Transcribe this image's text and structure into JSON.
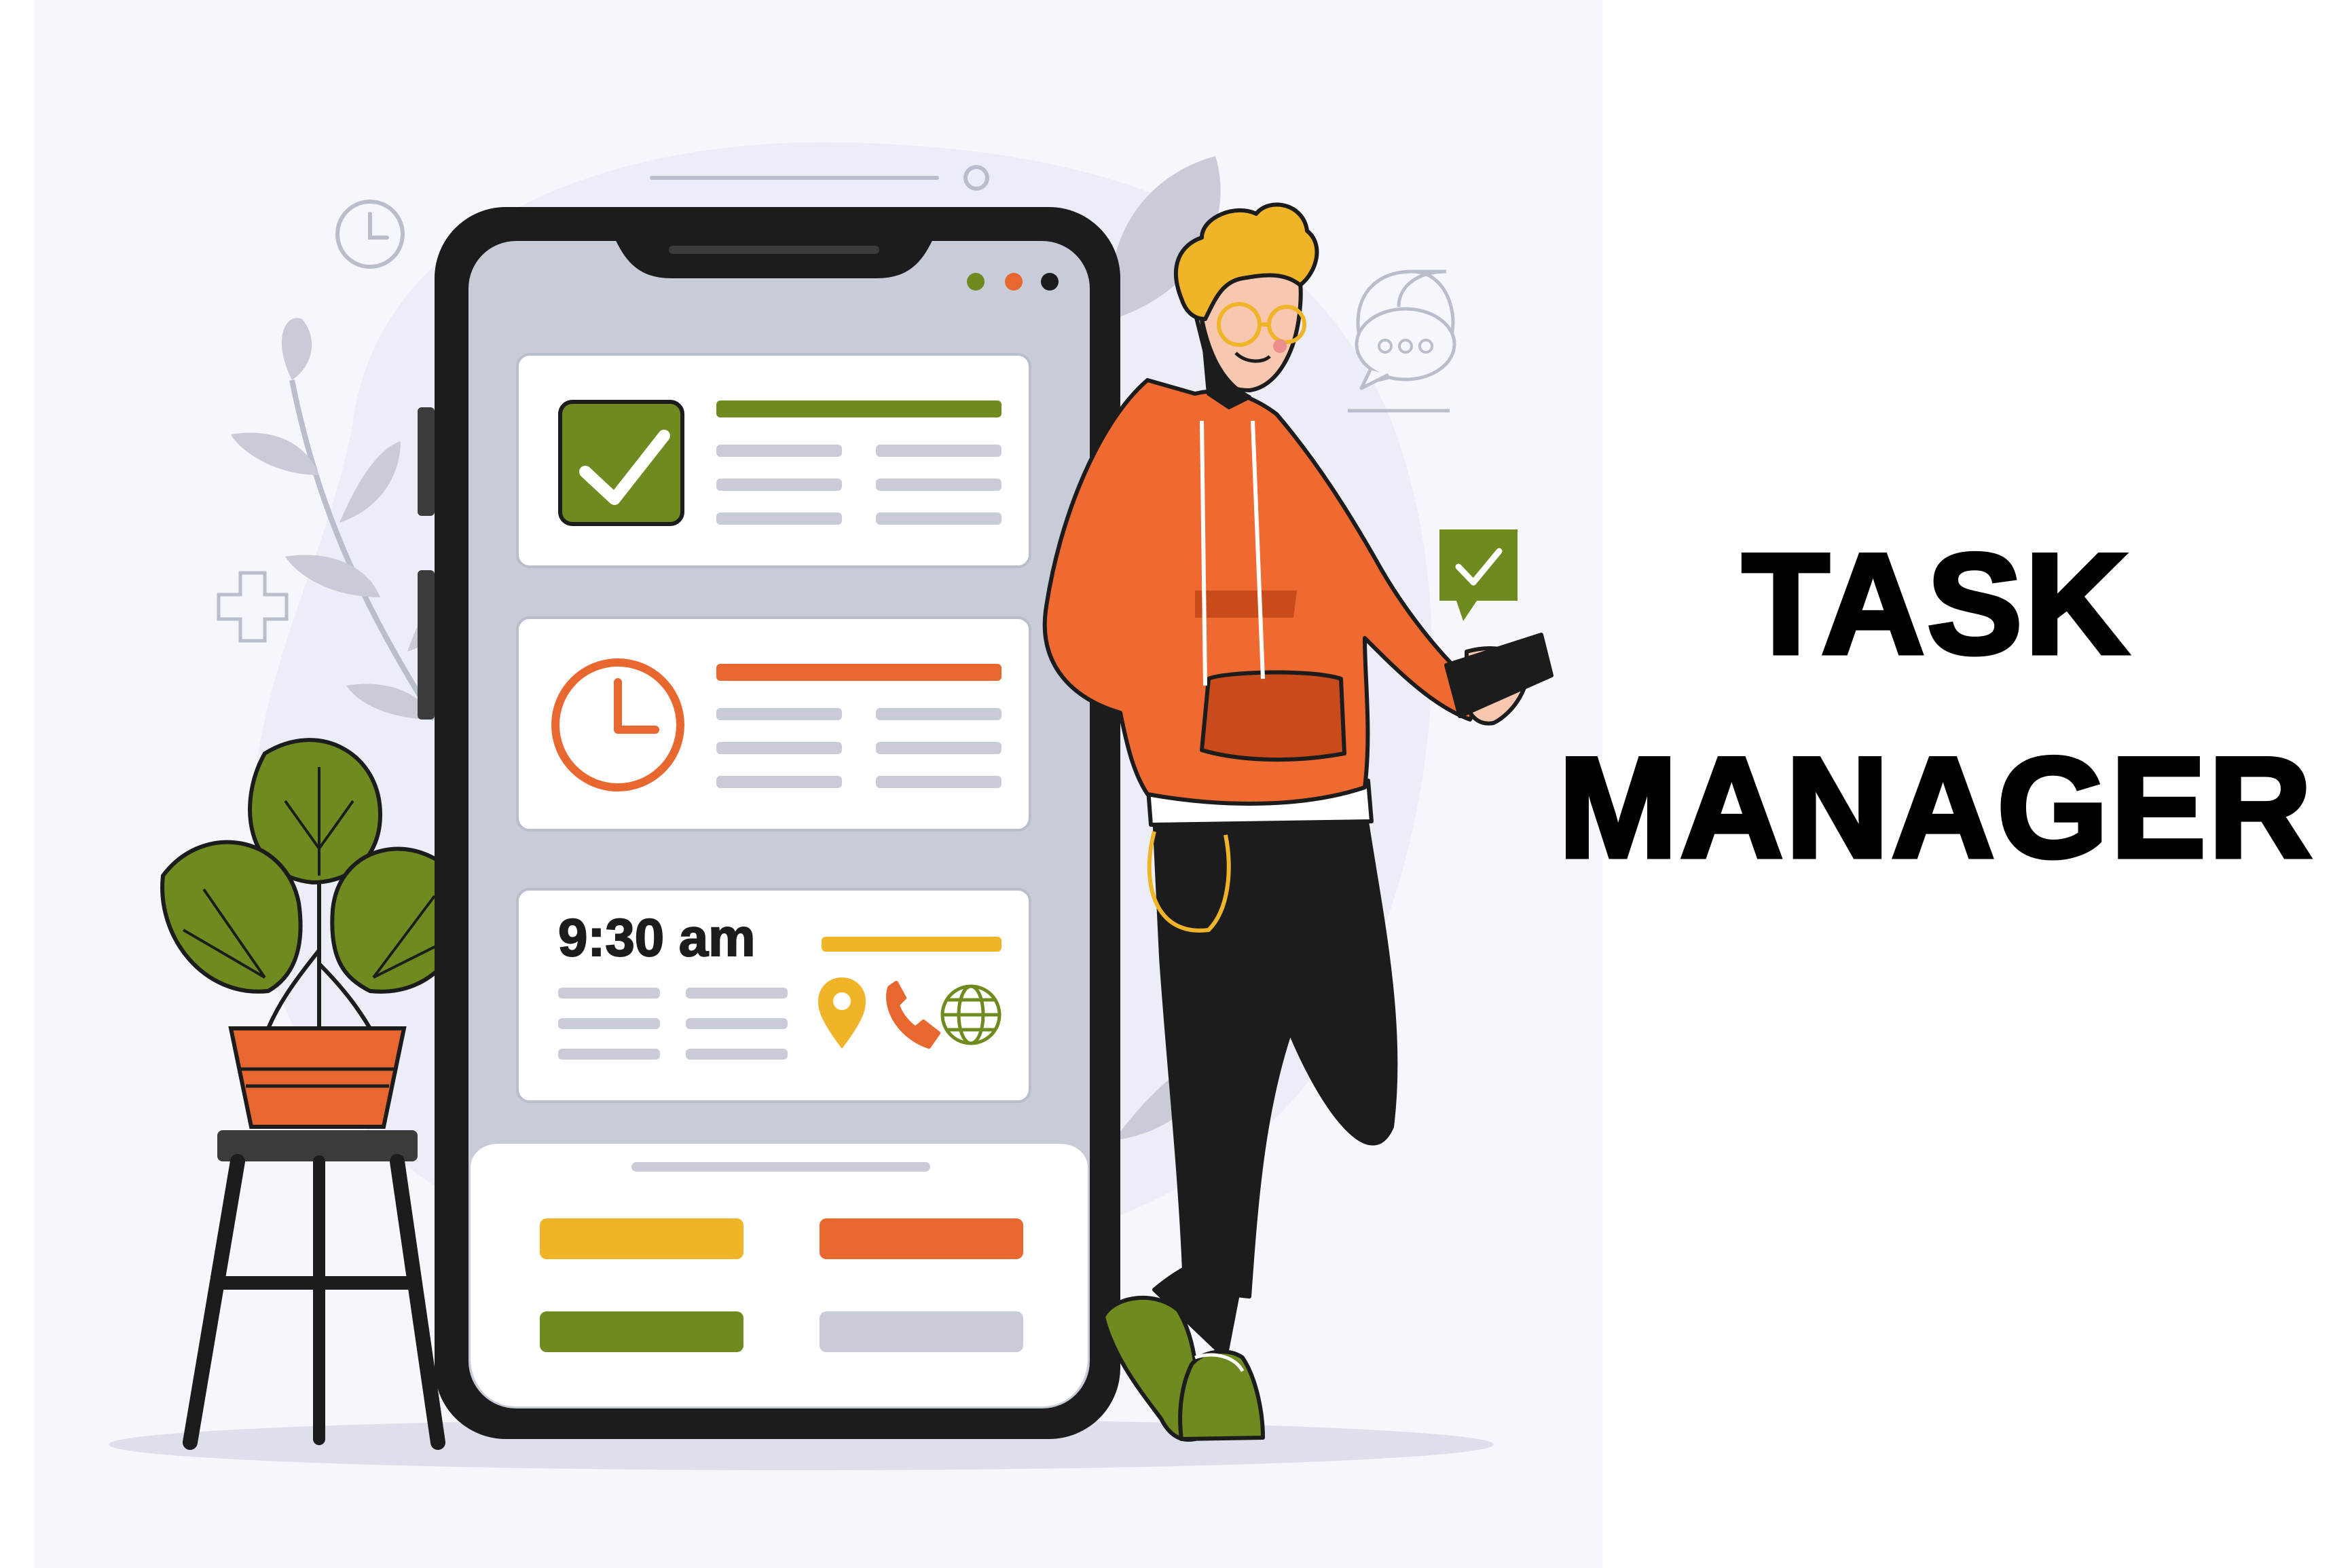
{
  "title": {
    "line1": "TASK",
    "line2": "MANAGER"
  },
  "phone": {
    "card3_time": "9:30 am",
    "status_dots": [
      "#6f8a1f",
      "#e8672f",
      "#1c1c1c"
    ]
  },
  "icons": {
    "card1": "checkbox-checked-icon",
    "card2": "clock-icon",
    "card3": [
      "location-pin-icon",
      "phone-icon",
      "globe-icon"
    ],
    "speech_bubble": "speech-bubble-icon",
    "check_bubble": "check-bubble-icon"
  },
  "colors": {
    "background_panel": "#f6f7fc",
    "olive": "#6f8a1f",
    "orange": "#e8672f",
    "yellow": "#f0b429",
    "grey_bar": "#c9ccd8",
    "screen_bg": "#c8cbd8",
    "dark": "#1c1c1c"
  }
}
